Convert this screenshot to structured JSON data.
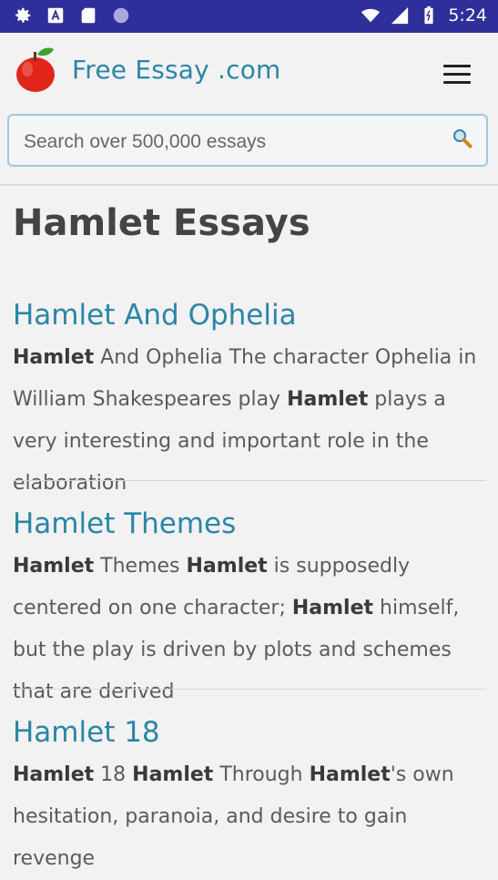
{
  "status_bar": {
    "time": "5:24",
    "icons_left": [
      "gear-icon",
      "a-icon",
      "sd-card-icon",
      "circle-icon"
    ],
    "icons_right": [
      "wifi-icon",
      "signal-icon",
      "battery-icon"
    ]
  },
  "header": {
    "brand": "Free Essay .com",
    "logo_icon": "apple-icon",
    "menu_icon": "hamburger-menu-icon"
  },
  "search": {
    "placeholder": "Search over 500,000 essays",
    "icon": "magnifier-icon"
  },
  "page": {
    "title": "Hamlet Essays"
  },
  "essays": [
    {
      "title": "Hamlet And Ophelia",
      "snippet_parts": [
        {
          "b": "Hamlet"
        },
        {
          "t": " And Ophelia The character Ophelia in William Shakespeares play "
        },
        {
          "b": "Hamlet"
        },
        {
          "t": " plays a very interesting and important role in the elaboration"
        }
      ]
    },
    {
      "title": "Hamlet Themes",
      "snippet_parts": [
        {
          "b": "Hamlet"
        },
        {
          "t": " Themes "
        },
        {
          "b": "Hamlet"
        },
        {
          "t": " is supposedly centered on one character; "
        },
        {
          "b": "Hamlet"
        },
        {
          "t": " himself, but the play is driven by plots and schemes that are derived"
        }
      ]
    },
    {
      "title": "Hamlet 18",
      "snippet_parts": [
        {
          "b": "Hamlet"
        },
        {
          "t": " 18 "
        },
        {
          "b": "Hamlet"
        },
        {
          "t": " Through "
        },
        {
          "b": "Hamlet"
        },
        {
          "t": "'s own hesitation, paranoia, and desire to gain revenge"
        }
      ]
    }
  ],
  "colors": {
    "status_bar": "#2f2f9c",
    "link": "#2b86a6",
    "title": "#444444",
    "body_text": "#5b5b5b",
    "search_border": "#9ec9dc"
  }
}
